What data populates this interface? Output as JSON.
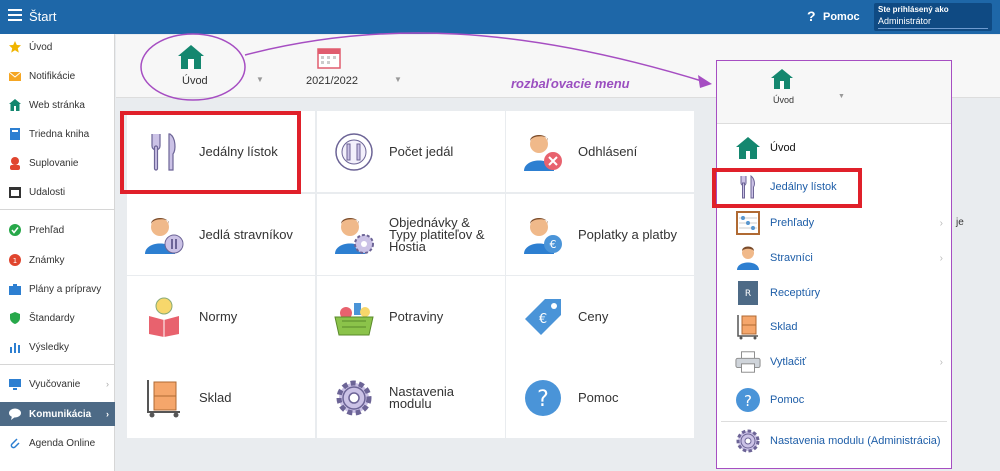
{
  "topbar": {
    "title": "Štart",
    "help_icon": "?",
    "help_label": "Pomoc",
    "login_caption": "Ste prihlásený ako",
    "login_role": "Administrátor"
  },
  "sidebar": {
    "items": [
      {
        "label": "Úvod",
        "icon": "star-icon",
        "color": "#f0b400"
      },
      {
        "label": "Notifikácie",
        "icon": "envelope-icon",
        "color": "#f5a623"
      },
      {
        "label": "Web stránka",
        "icon": "house-icon",
        "color": "#14876f"
      },
      {
        "label": "Triedna kniha",
        "icon": "book-icon",
        "color": "#2d7fd1"
      },
      {
        "label": "Suplovanie",
        "icon": "person-icon",
        "color": "#e0452e"
      },
      {
        "label": "Udalosti",
        "icon": "calendar-icon",
        "color": "#333333"
      },
      {
        "label": "Prehľad",
        "icon": "check-circle-icon",
        "color": "#27a84a"
      },
      {
        "label": "Známky",
        "icon": "grade-icon",
        "color": "#e0452e"
      },
      {
        "label": "Plány a prípravy",
        "icon": "briefcase-icon",
        "color": "#2d7fd1"
      },
      {
        "label": "Štandardy",
        "icon": "shield-icon",
        "color": "#27a84a"
      },
      {
        "label": "Výsledky",
        "icon": "chart-icon",
        "color": "#2d7fd1"
      },
      {
        "label": "Vyučovanie",
        "icon": "monitor-icon",
        "color": "#2d7fd1"
      },
      {
        "label": "Komunikácia",
        "icon": "chat-icon",
        "color": "#ffffff"
      },
      {
        "label": "Agenda Online",
        "icon": "paperclip-icon",
        "color": "#2d7fd1"
      }
    ]
  },
  "toolbar": {
    "home_label": "Úvod",
    "year_label": "2021/2022"
  },
  "annotation": "rozbaľovacie menu",
  "tiles": [
    {
      "label": "Jedálny lístok",
      "icon": "cutlery-icon"
    },
    {
      "label": "Počet jedál",
      "icon": "plate-icon"
    },
    {
      "label": "Odhlásení",
      "icon": "person-cancel-icon"
    },
    {
      "label": "Jedlá stravníkov",
      "icon": "person-cutlery-icon"
    },
    {
      "label": "Objednávky & Typy platiteľov & Hostia",
      "icon": "person-gear-icon"
    },
    {
      "label": "Poplatky a platby",
      "icon": "person-euro-icon"
    },
    {
      "label": "Normy",
      "icon": "reader-icon"
    },
    {
      "label": "Potraviny",
      "icon": "basket-icon"
    },
    {
      "label": "Ceny",
      "icon": "price-tag-icon"
    },
    {
      "label": "Sklad",
      "icon": "boxes-icon"
    },
    {
      "label": "Nastavenia modulu",
      "icon": "gear-icon"
    },
    {
      "label": "Pomoc",
      "icon": "question-icon"
    }
  ],
  "dropdown": {
    "head_label": "Úvod",
    "items": [
      {
        "label": "Úvod",
        "icon": "house-icon"
      },
      {
        "label": "Jedálny lístok",
        "icon": "cutlery-icon"
      },
      {
        "label": "Prehľady",
        "icon": "abacus-icon"
      },
      {
        "label": "Stravníci",
        "icon": "person-icon"
      },
      {
        "label": "Receptúry",
        "icon": "recipe-book-icon"
      },
      {
        "label": "Sklad",
        "icon": "boxes-icon"
      },
      {
        "label": "Vytlačiť",
        "icon": "printer-icon"
      },
      {
        "label": "Pomoc",
        "icon": "question-icon"
      },
      {
        "label": "Nastavenia modulu (Administrácia)",
        "icon": "gear-icon"
      }
    ]
  },
  "fragment": "je",
  "colors": {
    "topbar": "#1e67a8",
    "accent_red": "#e0202a",
    "annotation_purple": "#9b4fc0",
    "house_green": "#14876f"
  }
}
